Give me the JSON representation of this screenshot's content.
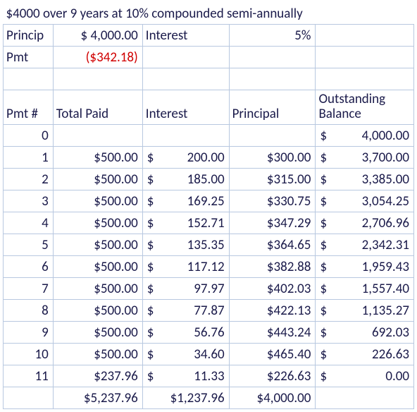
{
  "title": "$4000 over 9 years at 10% compounded semi-annually",
  "labels": {
    "principal": "Princip",
    "interest": "Interest",
    "pmt": "Pmt",
    "pmt_num": "Pmt #",
    "total_paid": "Total Paid",
    "col_interest": "Interest",
    "col_principal": "Principal",
    "col_balance": "Outstanding Balance"
  },
  "summary": {
    "principal": "$ 4,000.00",
    "interest_rate": "5%",
    "pmt": "($342.18)"
  },
  "rows": [
    {
      "n": "0",
      "paid": "",
      "interest": "",
      "principal": "",
      "balance": "4,000.00"
    },
    {
      "n": "1",
      "paid": "$500.00",
      "interest": "200.00",
      "principal": "$300.00",
      "balance": "3,700.00"
    },
    {
      "n": "2",
      "paid": "$500.00",
      "interest": "185.00",
      "principal": "$315.00",
      "balance": "3,385.00"
    },
    {
      "n": "3",
      "paid": "$500.00",
      "interest": "169.25",
      "principal": "$330.75",
      "balance": "3,054.25"
    },
    {
      "n": "4",
      "paid": "$500.00",
      "interest": "152.71",
      "principal": "$347.29",
      "balance": "2,706.96"
    },
    {
      "n": "5",
      "paid": "$500.00",
      "interest": "135.35",
      "principal": "$364.65",
      "balance": "2,342.31"
    },
    {
      "n": "6",
      "paid": "$500.00",
      "interest": "117.12",
      "principal": "$382.88",
      "balance": "1,959.43"
    },
    {
      "n": "7",
      "paid": "$500.00",
      "interest": "97.97",
      "principal": "$402.03",
      "balance": "1,557.40"
    },
    {
      "n": "8",
      "paid": "$500.00",
      "interest": "77.87",
      "principal": "$422.13",
      "balance": "1,135.27"
    },
    {
      "n": "9",
      "paid": "$500.00",
      "interest": "56.76",
      "principal": "$443.24",
      "balance": "692.03"
    },
    {
      "n": "10",
      "paid": "$500.00",
      "interest": "34.60",
      "principal": "$465.40",
      "balance": "226.63"
    },
    {
      "n": "11",
      "paid": "$237.96",
      "interest": "11.33",
      "principal": "$226.63",
      "balance": "0.00"
    }
  ],
  "totals": {
    "paid": "$5,237.96",
    "interest": "$1,237.96",
    "principal": "$4,000.00"
  },
  "chart_data": {
    "type": "table",
    "title": "$4000 over 9 years at 10% compounded semi-annually",
    "principal": 4000.0,
    "rate_per_period": 0.05,
    "payment_calc": -342.18,
    "columns": [
      "Pmt #",
      "Total Paid",
      "Interest",
      "Principal",
      "Outstanding Balance"
    ],
    "schedule": [
      {
        "pmt": 0,
        "paid": null,
        "interest": null,
        "principal": null,
        "balance": 4000.0
      },
      {
        "pmt": 1,
        "paid": 500.0,
        "interest": 200.0,
        "principal": 300.0,
        "balance": 3700.0
      },
      {
        "pmt": 2,
        "paid": 500.0,
        "interest": 185.0,
        "principal": 315.0,
        "balance": 3385.0
      },
      {
        "pmt": 3,
        "paid": 500.0,
        "interest": 169.25,
        "principal": 330.75,
        "balance": 3054.25
      },
      {
        "pmt": 4,
        "paid": 500.0,
        "interest": 152.71,
        "principal": 347.29,
        "balance": 2706.96
      },
      {
        "pmt": 5,
        "paid": 500.0,
        "interest": 135.35,
        "principal": 364.65,
        "balance": 2342.31
      },
      {
        "pmt": 6,
        "paid": 500.0,
        "interest": 117.12,
        "principal": 382.88,
        "balance": 1959.43
      },
      {
        "pmt": 7,
        "paid": 500.0,
        "interest": 97.97,
        "principal": 402.03,
        "balance": 1557.4
      },
      {
        "pmt": 8,
        "paid": 500.0,
        "interest": 77.87,
        "principal": 422.13,
        "balance": 1135.27
      },
      {
        "pmt": 9,
        "paid": 500.0,
        "interest": 56.76,
        "principal": 443.24,
        "balance": 692.03
      },
      {
        "pmt": 10,
        "paid": 500.0,
        "interest": 34.6,
        "principal": 465.4,
        "balance": 226.63
      },
      {
        "pmt": 11,
        "paid": 237.96,
        "interest": 11.33,
        "principal": 226.63,
        "balance": 0.0
      }
    ],
    "totals": {
      "paid": 5237.96,
      "interest": 1237.96,
      "principal": 4000.0
    }
  }
}
